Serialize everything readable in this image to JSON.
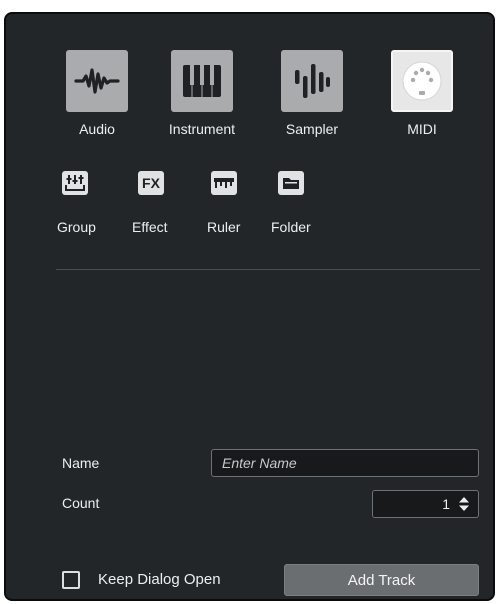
{
  "track_types": [
    {
      "label": "Audio",
      "icon": "audio-waveform-icon"
    },
    {
      "label": "Instrument",
      "icon": "piano-keys-icon"
    },
    {
      "label": "Sampler",
      "icon": "sampler-bars-icon"
    },
    {
      "label": "MIDI",
      "icon": "midi-connector-icon",
      "selected": true
    }
  ],
  "small_types": [
    {
      "label": "Group",
      "icon": "group-faders-icon",
      "glyph": ""
    },
    {
      "label": "Effect",
      "icon": "fx-icon",
      "glyph": "FX"
    },
    {
      "label": "Ruler",
      "icon": "ruler-icon",
      "glyph": ""
    },
    {
      "label": "Folder",
      "icon": "folder-icon",
      "glyph": ""
    }
  ],
  "form": {
    "name_label": "Name",
    "name_placeholder": "Enter Name",
    "name_value": "",
    "count_label": "Count",
    "count_value": "1"
  },
  "footer": {
    "keep_open_label": "Keep Dialog Open",
    "keep_open_checked": false,
    "add_button_label": "Add Track"
  },
  "colors": {
    "panel_bg": "#232629",
    "tile_bg": "#a9abac",
    "selected_tile_bg": "#e7e7e7",
    "text": "#eceff1"
  }
}
